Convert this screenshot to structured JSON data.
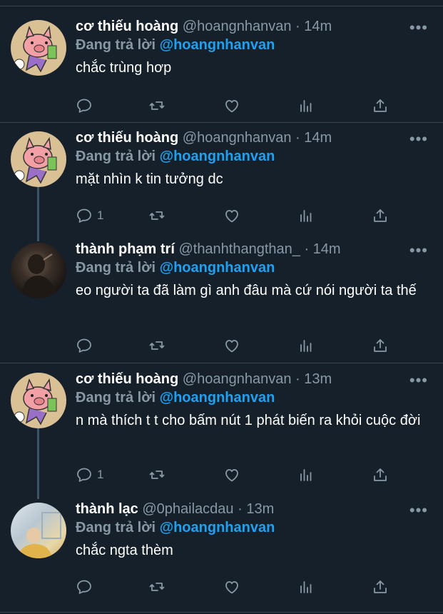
{
  "tweets": [
    {
      "name": "cơ thiếu hoàng",
      "handle": "@hoangnhanvan",
      "time": "· 14m",
      "reply_label": "Đang trả lời",
      "reply_to": "@hoangnhanvan",
      "text": "chắc trùng hơp",
      "reply_count": ""
    },
    {
      "name": "cơ thiếu hoàng",
      "handle": "@hoangnhanvan",
      "time": "· 14m",
      "reply_label": "Đang trả lời",
      "reply_to": "@hoangnhanvan",
      "text": "mặt nhìn k tin tưởng dc",
      "reply_count": "1"
    },
    {
      "name": "thành phạm trí",
      "handle": "@thanhthangthan_",
      "time": "· 14m",
      "reply_label": "Đang trả lời",
      "reply_to": "@hoangnhanvan",
      "text": "eo người ta đã làm gì anh đâu mà cứ nói người ta thế",
      "reply_count": ""
    },
    {
      "name": "cơ thiếu hoàng",
      "handle": "@hoangnhanvan",
      "time": "· 13m",
      "reply_label": "Đang trả lời",
      "reply_to": "@hoangnhanvan",
      "text": "n mà thích t t cho bấm nút 1 phát biến ra khỏi cuộc đời",
      "reply_count": "1"
    },
    {
      "name": "thành lạc",
      "handle": "@0phailacdau",
      "time": "· 13m",
      "reply_label": "Đang trả lời",
      "reply_to": "@hoangnhanvan",
      "text": "chắc ngta thèm",
      "reply_count": ""
    }
  ],
  "more_glyph": "•••",
  "icons": [
    "reply-icon",
    "retweet-icon",
    "like-icon",
    "analytics-icon",
    "share-icon",
    "more-icon"
  ],
  "colors": {
    "background": "#15202b",
    "secondary": "#8899a6",
    "mention": "#1da1f2",
    "separator": "#38444d"
  }
}
